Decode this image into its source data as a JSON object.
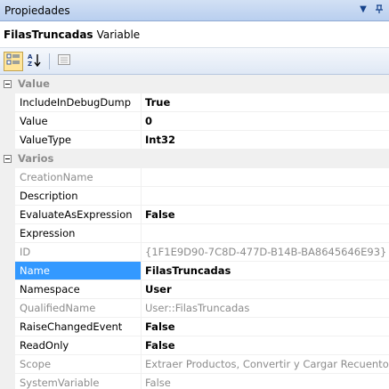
{
  "panel": {
    "title": "Propiedades"
  },
  "object": {
    "name": "FilasTruncadas",
    "type": "Variable"
  },
  "toolbar": {
    "buttons": [
      {
        "icon": "categorized-icon",
        "active": true
      },
      {
        "icon": "alphabetical-icon",
        "active": false
      },
      {
        "icon": "property-pages-icon",
        "active": false
      }
    ]
  },
  "categories": {
    "value": "Value",
    "varios": "Varios"
  },
  "props": {
    "include_in_debug_dump": {
      "name": "IncludeInDebugDump",
      "value": "True"
    },
    "value": {
      "name": "Value",
      "value": "0"
    },
    "value_type": {
      "name": "ValueType",
      "value": "Int32"
    },
    "creation_name": {
      "name": "CreationName",
      "value": ""
    },
    "description": {
      "name": "Description",
      "value": ""
    },
    "evaluate_as_expression": {
      "name": "EvaluateAsExpression",
      "value": "False"
    },
    "expression": {
      "name": "Expression",
      "value": ""
    },
    "id": {
      "name": "ID",
      "value": "{1F1E9D90-7C8D-477D-B14B-BA8645646E93}"
    },
    "name": {
      "name": "Name",
      "value": "FilasTruncadas"
    },
    "namespace": {
      "name": "Namespace",
      "value": "User"
    },
    "qualified_name": {
      "name": "QualifiedName",
      "value": "User::FilasTruncadas"
    },
    "raise_changed_event": {
      "name": "RaiseChangedEvent",
      "value": "False"
    },
    "read_only": {
      "name": "ReadOnly",
      "value": "False"
    },
    "scope": {
      "name": "Scope",
      "value": "Extraer Productos, Convertir y Cargar Recuento"
    },
    "system_variable": {
      "name": "SystemVariable",
      "value": "False"
    }
  },
  "colors": {
    "selection": "#3399ff",
    "gutter": "#f0f0f0",
    "disabled_text": "#8c8c8c"
  }
}
